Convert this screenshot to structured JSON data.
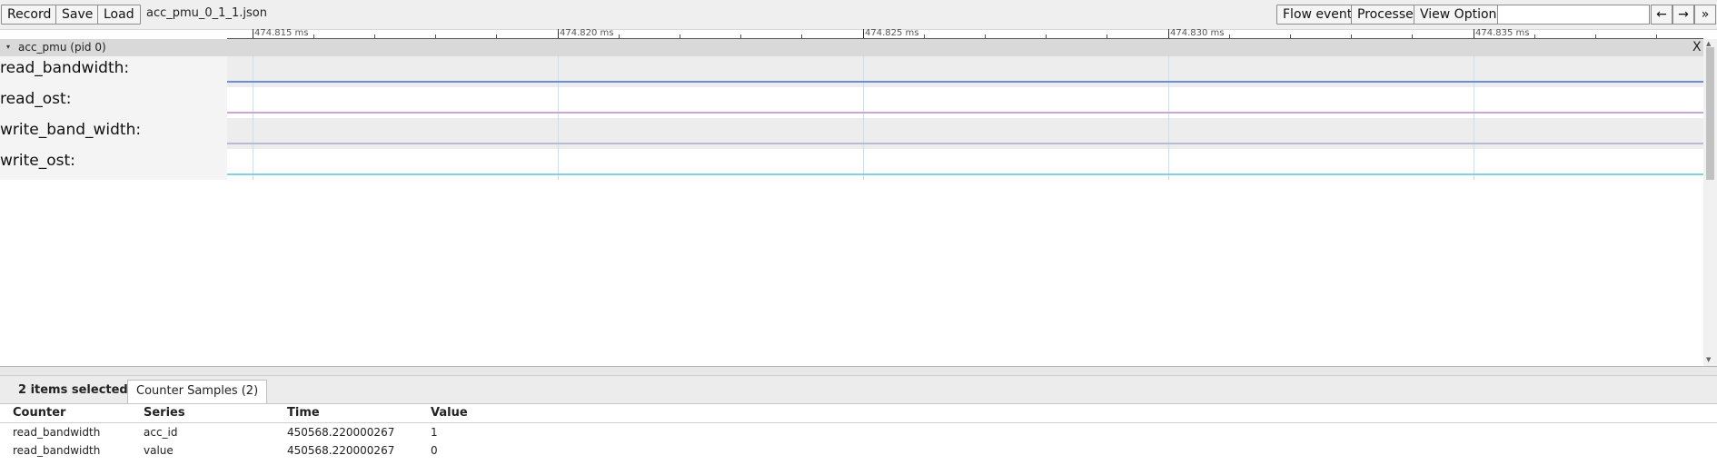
{
  "toolbar": {
    "buttons": [
      "Record",
      "Save",
      "Load"
    ],
    "filename": "acc_pmu_0_1_1.json",
    "right_buttons": [
      "Flow events",
      "Processes",
      "View Options"
    ],
    "search_value": "",
    "nav": [
      "←",
      "→",
      "»"
    ]
  },
  "ruler": {
    "labels": [
      "474.815 ms",
      "474.820 ms",
      "474.825 ms",
      "474.830 ms",
      "474.835 ms"
    ]
  },
  "process": {
    "arrow": "▾",
    "label": "acc_pmu (pid 0)",
    "close": "X"
  },
  "tracks": [
    {
      "label": "read_bandwidth:",
      "color": "#6f8ed8"
    },
    {
      "label": "read_ost:",
      "color": "#c9a6d2"
    },
    {
      "label": "write_band_width:",
      "color": "#b9b9d2"
    },
    {
      "label": "write_ost:",
      "color": "#7fd3e4"
    }
  ],
  "panel": {
    "selection_text": "2 items selected.",
    "tab_label": "Counter Samples (2)",
    "columns": [
      "Counter",
      "Series",
      "Time",
      "Value"
    ],
    "rows": [
      [
        "read_bandwidth",
        "acc_id",
        "450568.220000267",
        "1"
      ],
      [
        "read_bandwidth",
        "value",
        "450568.220000267",
        "0"
      ]
    ]
  },
  "scroll": {
    "up": "▲",
    "down": "▼"
  }
}
